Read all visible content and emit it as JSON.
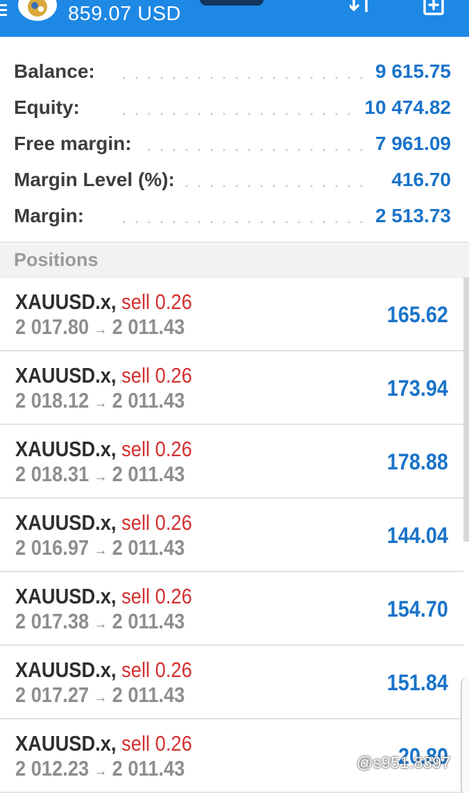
{
  "header": {
    "amount": "859.07 USD",
    "icons": [
      "menu-icon",
      "avatar",
      "sort-icon",
      "add-order-icon"
    ]
  },
  "summary": [
    {
      "label": "Balance:",
      "value": "9 615.75"
    },
    {
      "label": "Equity:",
      "value": "10 474.82"
    },
    {
      "label": "Free margin:",
      "value": "7 961.09"
    },
    {
      "label": "Margin Level (%):",
      "value": "416.70"
    },
    {
      "label": "Margin:",
      "value": "2 513.73"
    }
  ],
  "positions_title": "Positions",
  "positions": [
    {
      "symbol": "XAUUSD.x",
      "side": "sell 0.26",
      "open": "2 017.80",
      "current": "2 011.43",
      "profit": "165.62"
    },
    {
      "symbol": "XAUUSD.x",
      "side": "sell 0.26",
      "open": "2 018.12",
      "current": "2 011.43",
      "profit": "173.94"
    },
    {
      "symbol": "XAUUSD.x",
      "side": "sell 0.26",
      "open": "2 018.31",
      "current": "2 011.43",
      "profit": "178.88"
    },
    {
      "symbol": "XAUUSD.x",
      "side": "sell 0.26",
      "open": "2 016.97",
      "current": "2 011.43",
      "profit": "144.04"
    },
    {
      "symbol": "XAUUSD.x",
      "side": "sell 0.26",
      "open": "2 017.38",
      "current": "2 011.43",
      "profit": "154.70"
    },
    {
      "symbol": "XAUUSD.x",
      "side": "sell 0.26",
      "open": "2 017.27",
      "current": "2 011.43",
      "profit": "151.84"
    },
    {
      "symbol": "XAUUSD.x",
      "side": "sell 0.26",
      "open": "2 012.23",
      "current": "2 011.43",
      "profit": "20.80"
    }
  ],
  "arrow": "→",
  "comma": ",",
  "watermark": "@s951.8397",
  "colors": {
    "header": "#1e88e5",
    "value_blue": "#1a73c9",
    "sell_red": "#d32f2f",
    "label": "#3d3d3d",
    "muted": "#8e8e8e"
  }
}
